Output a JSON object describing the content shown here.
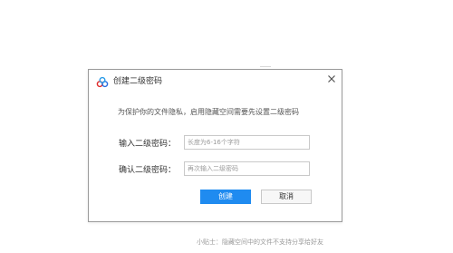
{
  "dialog": {
    "title": "创建二级密码",
    "app_icon": "baidu-cloud-icon",
    "close_icon": "close-icon",
    "hint": "为保护你的文件隐私，启用隐藏空间需要先设置二级密码",
    "fields": [
      {
        "label": "输入二级密码：",
        "value": "",
        "placeholder": "长度为6-16个字符"
      },
      {
        "label": "确认二级密码：",
        "value": "",
        "placeholder": "再次输入二级密码"
      }
    ],
    "buttons": {
      "create_label": "创建",
      "cancel_label": "取消"
    }
  },
  "footer": {
    "tip": "小贴士：隐藏空间中的文件不支持分享给好友"
  },
  "colors": {
    "accent": "#1f8bf0",
    "border": "#9a9a9a",
    "placeholder": "#9b9b9b",
    "tip": "#999999"
  }
}
